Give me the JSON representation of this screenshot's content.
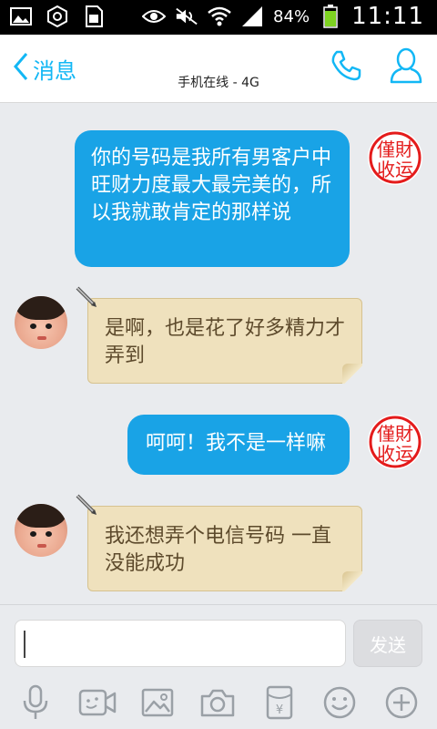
{
  "status_bar": {
    "battery_percent": "84%",
    "time": "11:11",
    "icons": [
      "image-icon",
      "settings-icon",
      "sim-icon",
      "eye-icon",
      "mute-icon",
      "wifi-icon",
      "signal-icon",
      "battery-icon"
    ]
  },
  "header": {
    "back_label": "消息",
    "contact_name": "",
    "status": "手机在线 - 4G",
    "call_icon": "phone-icon",
    "profile_icon": "person-icon"
  },
  "messages": [
    {
      "direction": "out",
      "text": "你的号码是我所有男客户中旺财力度最大最完美的，所以我就敢肯定的那样说"
    },
    {
      "direction": "in",
      "text": "是啊，也是花了好多精力才弄到"
    },
    {
      "direction": "out",
      "text": "呵呵！我不是一样嘛"
    },
    {
      "direction": "in",
      "text": "我还想弄个电信号码 一直没能成功"
    }
  ],
  "input": {
    "value": "",
    "placeholder": "",
    "send_label": "发送"
  },
  "toolbar": [
    "microphone-icon",
    "video-icon",
    "image-icon",
    "camera-icon",
    "red-packet-icon",
    "emoji-icon",
    "plus-icon"
  ],
  "colors": {
    "accent": "#12b7f5",
    "bubble_out": "#19a3e6",
    "bubble_in": "#efe1bd",
    "background": "#e9ebee"
  }
}
